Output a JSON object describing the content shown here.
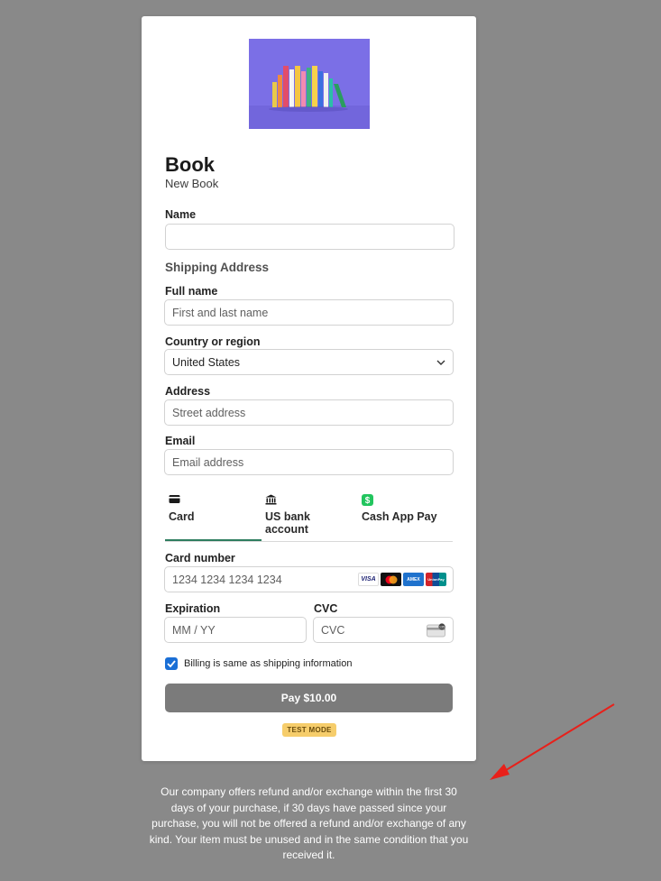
{
  "product": {
    "title": "Book",
    "subtitle": "New Book"
  },
  "form": {
    "name_label": "Name",
    "name_value": "",
    "shipping_title": "Shipping Address",
    "full_name_label": "Full name",
    "full_name_placeholder": "First and last name",
    "country_label": "Country or region",
    "country_value": "United States",
    "address_label": "Address",
    "address_placeholder": "Street address",
    "email_label": "Email",
    "email_placeholder": "Email address"
  },
  "payment_tabs": [
    {
      "label": "Card",
      "icon": "card-icon",
      "active": true
    },
    {
      "label": "US bank account",
      "icon": "bank-icon",
      "active": false
    },
    {
      "label": "Cash App Pay",
      "icon": "cash-app-icon",
      "active": false
    }
  ],
  "card": {
    "number_label": "Card number",
    "number_placeholder": "1234 1234 1234 1234",
    "expiration_label": "Expiration",
    "expiration_placeholder": "MM / YY",
    "cvc_label": "CVC",
    "cvc_placeholder": "CVC",
    "brands": [
      "VISA",
      "Mastercard",
      "AMEX",
      "UnionPay"
    ]
  },
  "billing": {
    "label": "Billing is same as shipping information",
    "checked": true
  },
  "pay_button": {
    "label": "Pay $10.00"
  },
  "test_mode_badge": "TEST MODE",
  "policy_text": "Our company offers refund and/or exchange within the first 30 days of your purchase, if 30 days have passed since your purchase, you will not be offered a refund and/or exchange of any kind. Your item must be unused and in the same condition that you received it.",
  "colors": {
    "page_background": "#898989",
    "tab_active_underline": "#2e7d5f",
    "checkbox": "#1a6fd6",
    "pay_button": "#7b7b7b",
    "test_badge": "#f6cd6b",
    "product_image_bg": "#7b6fe6",
    "annotation_arrow": "#e8201a"
  }
}
